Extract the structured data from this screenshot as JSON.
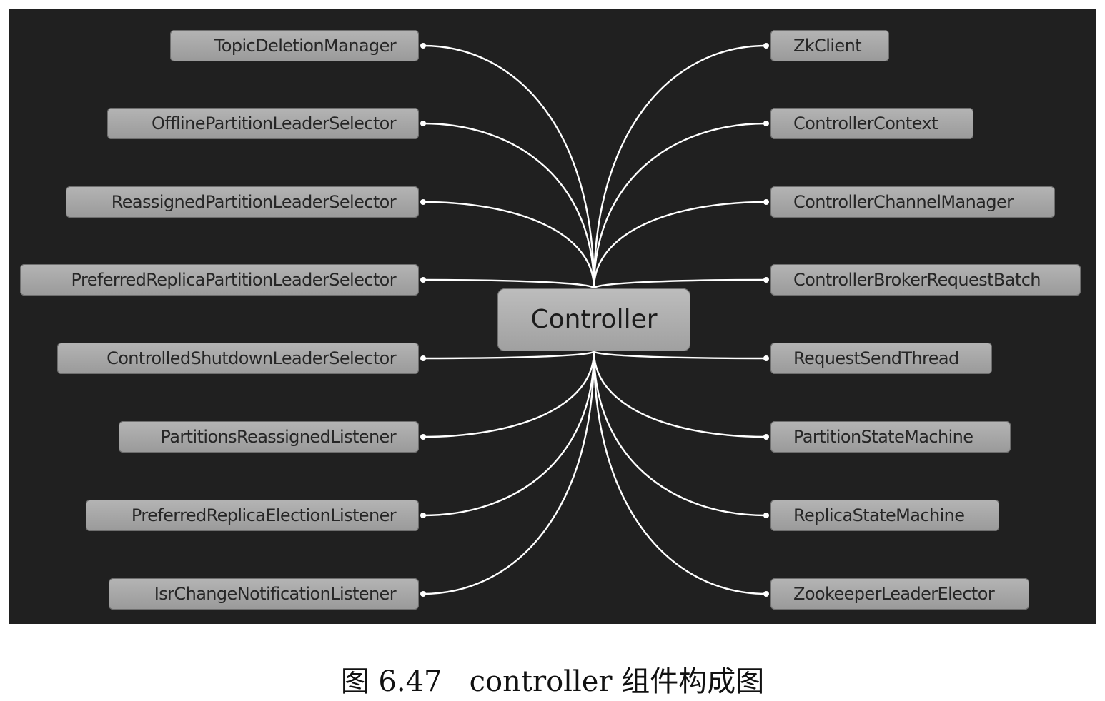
{
  "diagram": {
    "center_label": "Controller",
    "left_nodes": [
      "TopicDeletionManager",
      "OfflinePartitionLeaderSelector",
      "ReassignedPartitionLeaderSelector",
      "PreferredReplicaPartitionLeaderSelector",
      "ControlledShutdownLeaderSelector",
      "PartitionsReassignedListener",
      "PreferredReplicaElectionListener",
      "IsrChangeNotificationListener"
    ],
    "right_nodes": [
      "ZkClient",
      "ControllerContext",
      "ControllerChannelManager",
      "ControllerBrokerRequestBatch",
      "RequestSendThread",
      "PartitionStateMachine",
      "ReplicaStateMachine",
      "ZookeeperLeaderElector"
    ]
  },
  "caption": "图 6.47   controller 组件构成图",
  "colors": {
    "background": "#202020",
    "node_fill": "#a8a8a8",
    "link": "#ffffff"
  }
}
